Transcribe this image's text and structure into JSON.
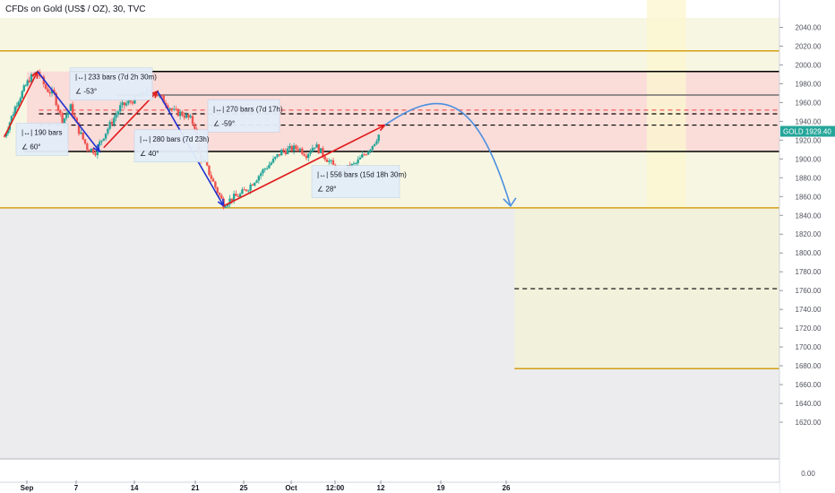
{
  "header": {
    "title": "CFDs on Gold (US$ / OZ), 30, TVC"
  },
  "price_tag": {
    "label": "GOLD",
    "value": "1929.40",
    "color": "#26a69a"
  },
  "colors": {
    "up": "#26a69a",
    "down": "#ef5350",
    "zone_pink": "#fbd3d6",
    "zone_yellow": "#f4f2d6",
    "zone_gray": "#dcdde0",
    "gold_line": "#d4a017",
    "blue_arrow": "#1f2fd0",
    "red_arrow": "#e01b1b",
    "curve": "#4a8fe0"
  },
  "chart_data": {
    "type": "candlestick",
    "symbol": "GOLD",
    "timeframe": "30",
    "y_range": [
      1600,
      2050
    ],
    "y_ticks": [
      "2040.00",
      "2020.00",
      "2000.00",
      "1980.00",
      "1960.00",
      "1940.00",
      "1920.00",
      "1900.00",
      "1880.00",
      "1860.00",
      "1840.00",
      "1820.00",
      "1800.00",
      "1780.00",
      "1760.00",
      "1740.00",
      "1720.00",
      "1700.00",
      "1680.00",
      "1660.00",
      "1640.00",
      "1620.00"
    ],
    "volume_tick": "0.00",
    "x_labels": [
      "Sep",
      "7",
      "14",
      "21",
      "25",
      "Oct",
      "12:00",
      "12",
      "19",
      "26"
    ],
    "last_price": 1929.4,
    "price_path": [
      {
        "t": 0,
        "p": 1924
      },
      {
        "t": 3,
        "p": 1960
      },
      {
        "t": 6,
        "p": 1985
      },
      {
        "t": 8,
        "p": 1993
      },
      {
        "t": 10,
        "p": 1975
      },
      {
        "t": 12,
        "p": 1968
      },
      {
        "t": 14,
        "p": 1940
      },
      {
        "t": 16,
        "p": 1955
      },
      {
        "t": 18,
        "p": 1930
      },
      {
        "t": 20,
        "p": 1912
      },
      {
        "t": 22,
        "p": 1908
      },
      {
        "t": 24,
        "p": 1925
      },
      {
        "t": 26,
        "p": 1940
      },
      {
        "t": 28,
        "p": 1955
      },
      {
        "t": 30,
        "p": 1960
      },
      {
        "t": 32,
        "p": 1965
      },
      {
        "t": 34,
        "p": 1970
      },
      {
        "t": 36,
        "p": 1972
      },
      {
        "t": 37,
        "p": 1968
      },
      {
        "t": 39,
        "p": 1960
      },
      {
        "t": 41,
        "p": 1950
      },
      {
        "t": 43,
        "p": 1948
      },
      {
        "t": 45,
        "p": 1942
      },
      {
        "t": 46,
        "p": 1935
      },
      {
        "t": 47,
        "p": 1905
      },
      {
        "t": 49,
        "p": 1890
      },
      {
        "t": 51,
        "p": 1870
      },
      {
        "t": 53,
        "p": 1852
      },
      {
        "t": 55,
        "p": 1858
      },
      {
        "t": 57,
        "p": 1862
      },
      {
        "t": 59,
        "p": 1870
      },
      {
        "t": 61,
        "p": 1880
      },
      {
        "t": 63,
        "p": 1890
      },
      {
        "t": 65,
        "p": 1898
      },
      {
        "t": 67,
        "p": 1908
      },
      {
        "t": 69,
        "p": 1910
      },
      {
        "t": 71,
        "p": 1912
      },
      {
        "t": 73,
        "p": 1905
      },
      {
        "t": 75,
        "p": 1915
      },
      {
        "t": 77,
        "p": 1905
      },
      {
        "t": 79,
        "p": 1895
      },
      {
        "t": 81,
        "p": 1885
      },
      {
        "t": 83,
        "p": 1890
      },
      {
        "t": 85,
        "p": 1895
      },
      {
        "t": 87,
        "p": 1905
      },
      {
        "t": 89,
        "p": 1915
      },
      {
        "t": 91,
        "p": 1929.4
      }
    ],
    "levels": [
      {
        "price": 2015,
        "style": "gold",
        "from": 0,
        "to": 1.0
      },
      {
        "price": 1993,
        "style": "black",
        "from": 0.09,
        "to": 1.0
      },
      {
        "price": 1968,
        "style": "gray",
        "from": 0.15,
        "to": 1.0
      },
      {
        "price": 1952,
        "style": "red-dash",
        "from": 0.05,
        "to": 1.0
      },
      {
        "price": 1948,
        "style": "black-dash",
        "from": 0.05,
        "to": 1.0
      },
      {
        "price": 1936,
        "style": "black-dash",
        "from": 0.05,
        "to": 1.0
      },
      {
        "price": 1908,
        "style": "black",
        "from": 0.03,
        "to": 1.0
      },
      {
        "price": 1848,
        "style": "gold",
        "from": 0,
        "to": 1.0
      },
      {
        "price": 1762,
        "style": "black-dash",
        "from": 0.66,
        "to": 1.0
      },
      {
        "price": 1677,
        "style": "gold",
        "from": 0.66,
        "to": 1.0
      }
    ],
    "measure_boxes": [
      {
        "bars": "233 bars (7d 2h 30m)",
        "angle": "-53°"
      },
      {
        "bars": "270 bars (7d 17h)",
        "angle": "-59°"
      },
      {
        "bars": "190 bars",
        "angle": "60°"
      },
      {
        "bars": "280 bars (7d 23h)",
        "angle": "40°"
      },
      {
        "bars": "556 bars (15d 18h 30m)",
        "angle": "28°"
      }
    ]
  }
}
